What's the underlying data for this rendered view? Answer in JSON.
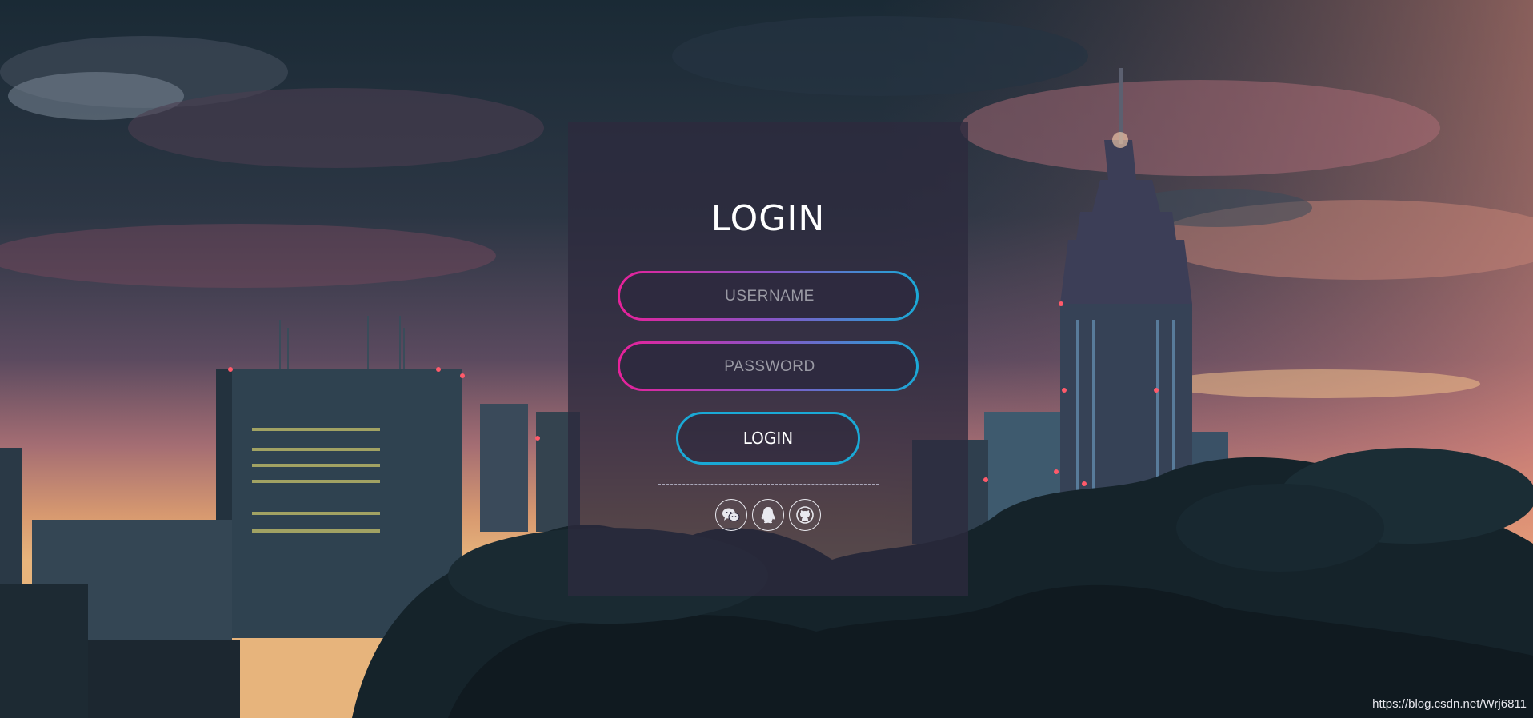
{
  "login": {
    "title": "LOGIN",
    "username_placeholder": "USERNAME",
    "password_placeholder": "PASSWORD",
    "submit_label": "LOGIN"
  },
  "social": [
    {
      "icon": "wechat-icon"
    },
    {
      "icon": "qq-penguin-icon"
    },
    {
      "icon": "github-icon"
    }
  ],
  "watermark": "https://blog.csdn.net/Wrj6811",
  "colors": {
    "gradient_start": "#e8219a",
    "gradient_mid": "#8a53c6",
    "gradient_end": "#1aa9d6",
    "card_bg": "#2d2a3e",
    "text": "#ffffff"
  }
}
